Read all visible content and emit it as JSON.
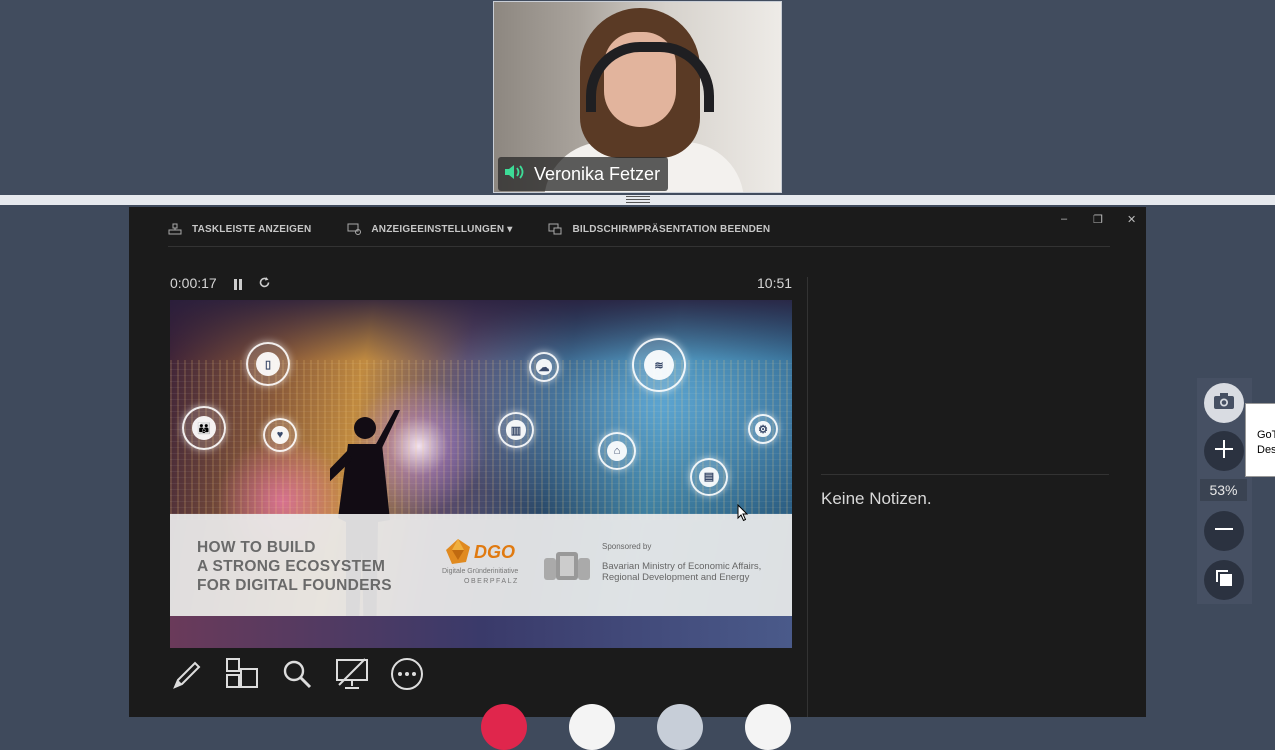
{
  "participant": {
    "name": "Veronika Fetzer"
  },
  "presenter_toolbar": {
    "show_taskbar": "TASKLEISTE ANZEIGEN",
    "display_settings": "ANZEIGEEINSTELLUNGEN ▾",
    "end_presentation": "BILDSCHIRMPRÄSENTATION BEENDEN"
  },
  "window_controls": {
    "minimize": "‒",
    "restore": "❐",
    "close": "✕"
  },
  "timer": {
    "elapsed": "0:00:17",
    "clock": "10:51"
  },
  "notes": {
    "text": "Keine Notizen."
  },
  "slide": {
    "title_line1": "HOW TO BUILD",
    "title_line2": "A STRONG ECOSYSTEM",
    "title_line3": "FOR DIGITAL FOUNDERS",
    "logo_name": "DGO",
    "logo_sub1": "Digitale Gründerinitiative",
    "logo_sub2": "OBERPFALZ",
    "sponsored_by": "Sponsored by",
    "sponsor_line1": "Bavarian Ministry of Economic Affairs,",
    "sponsor_line2": "Regional Development and Energy"
  },
  "zoom": {
    "level": "53%"
  },
  "tooltip": {
    "line1": "GoT",
    "line2": "Des"
  },
  "colors": {
    "background": "#3f4a5c",
    "presenter_bg": "#1b1b1b",
    "speaker_icon": "#3ddc97",
    "end_call": "#e0264c"
  },
  "icons": [
    "speaker-icon",
    "taskbar-icon",
    "display-settings-icon",
    "end-presentation-icon",
    "pause-icon",
    "restart-icon",
    "pen-icon",
    "slides-overview-icon",
    "zoom-search-icon",
    "black-screen-icon",
    "more-icon",
    "camera-icon",
    "plus-icon",
    "minus-icon",
    "copy-icon"
  ]
}
